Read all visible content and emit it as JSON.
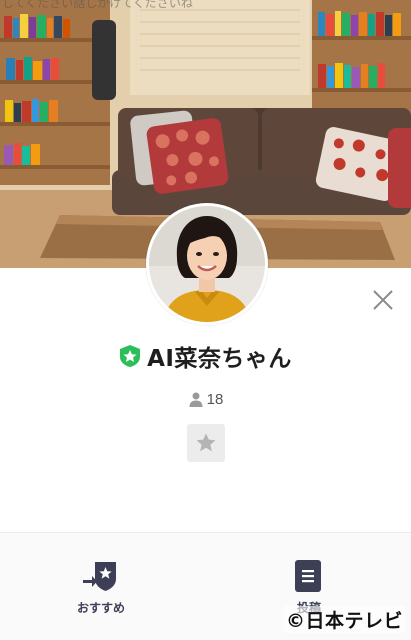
{
  "cover": {
    "caption": "してください話しかけてくださいね"
  },
  "profile": {
    "name": "AI菜奈ちゃん",
    "friend_count": "18"
  },
  "bottom_nav": {
    "items": [
      {
        "label": "おすすめ",
        "icon": "recommend-icon"
      },
      {
        "label": "投稿",
        "icon": "post-icon"
      }
    ]
  },
  "watermark": {
    "text": "©日本テレビ"
  },
  "colors": {
    "official_badge": "#2cbf59",
    "bar_icon": "#3c3f55",
    "favorite_bg": "#ececec",
    "favorite_star": "#b4b4b4"
  }
}
